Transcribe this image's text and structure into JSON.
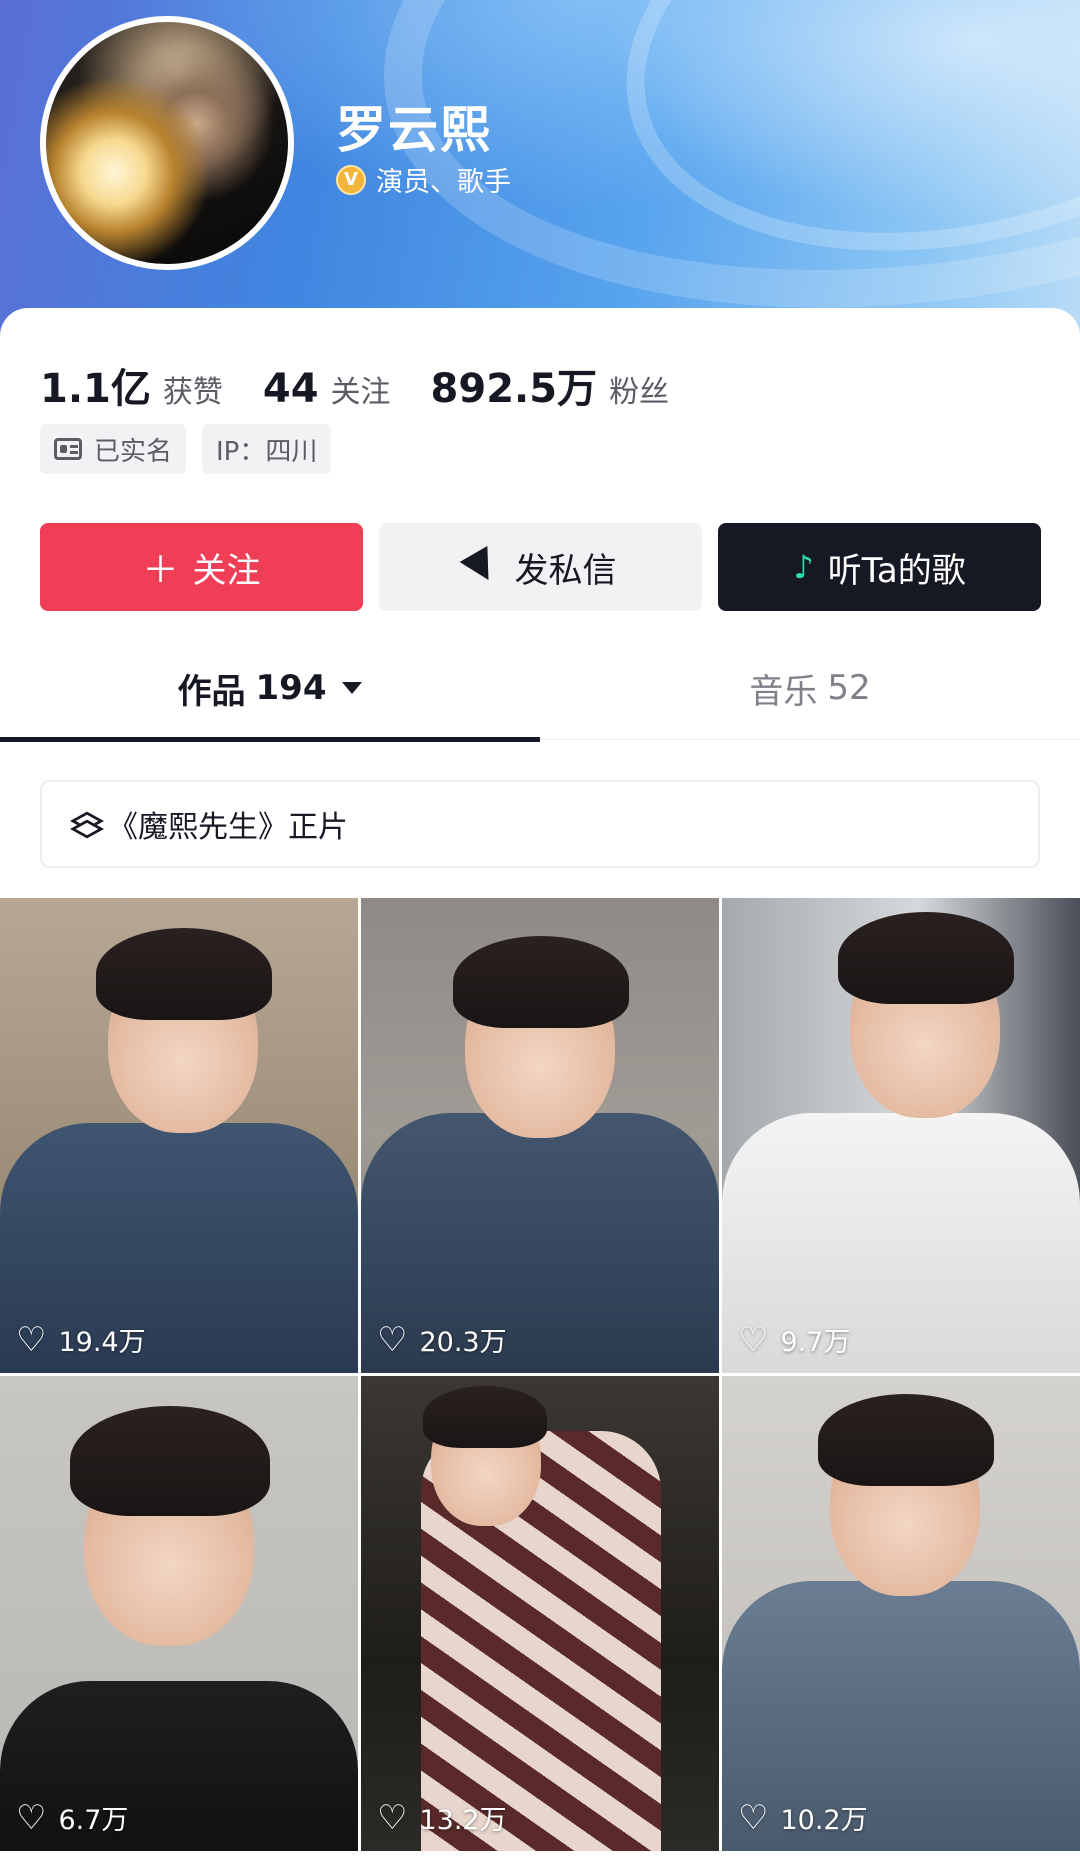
{
  "profile": {
    "name": "罗云熙",
    "verify_badge": "V",
    "verify_text": "演员、歌手"
  },
  "stats": [
    {
      "num": "1.1亿",
      "label": "获赞"
    },
    {
      "num": "44",
      "label": "关注"
    },
    {
      "num": "892.5万",
      "label": "粉丝"
    }
  ],
  "tags": {
    "realname": "已实名",
    "ip": "IP：四川"
  },
  "actions": {
    "follow_label": "关注",
    "follow_glyph": "＋",
    "message_label": "发私信",
    "songs_label": "听Ta的歌"
  },
  "tabs": {
    "works_label": "作品",
    "works_count": "194",
    "music_label": "音乐",
    "music_count": "52"
  },
  "collection": {
    "label": "《魔熙先生》正片"
  },
  "videos": [
    {
      "likes": "19.4万"
    },
    {
      "likes": "20.3万"
    },
    {
      "likes": "9.7万"
    },
    {
      "likes": "6.7万"
    },
    {
      "likes": "13.2万"
    },
    {
      "likes": "10.2万"
    }
  ],
  "colors": {
    "follow_button": "#ef3e55",
    "dark_button": "#161823",
    "verify_badge": "#f3b53a"
  }
}
